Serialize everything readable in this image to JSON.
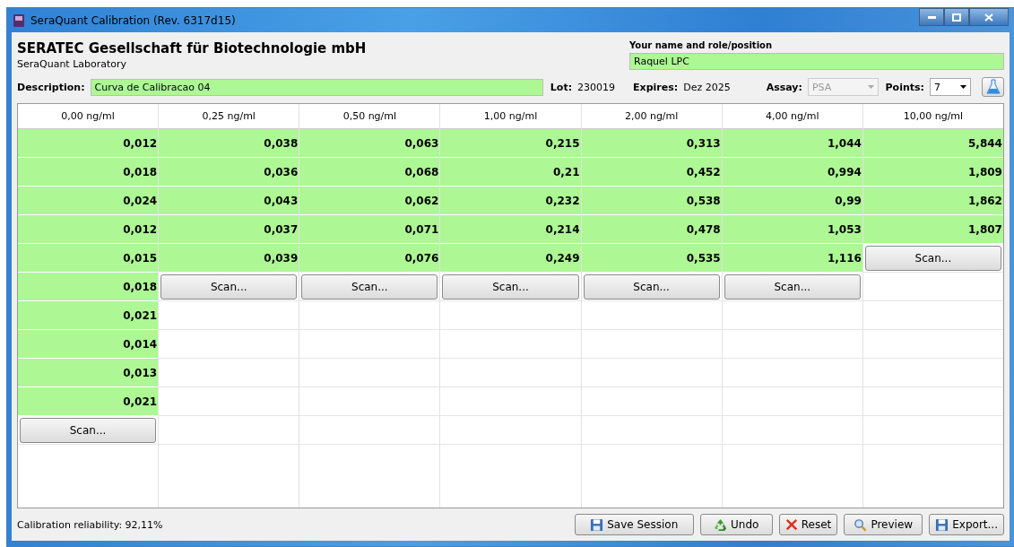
{
  "window": {
    "title": "SeraQuant Calibration (Rev. 6317d15)"
  },
  "header": {
    "company": "SERATEC Gesellschaft für Biotechnologie mbH",
    "subtitle": "SeraQuant Laboratory",
    "name_label": "Your name and role/position",
    "name_value": "Raquel LPC"
  },
  "info": {
    "description_label": "Description:",
    "description_value": "Curva de Calibracao 04",
    "lot_label": "Lot:",
    "lot_value": "230019",
    "expires_label": "Expires:",
    "expires_value": "Dez 2025",
    "assay_label": "Assay:",
    "assay_value": "PSA",
    "assay_disabled": true,
    "points_label": "Points:",
    "points_value": "7"
  },
  "columns": [
    {
      "header": "0,00 ng/ml",
      "values": [
        "0,012",
        "0,018",
        "0,024",
        "0,012",
        "0,015",
        "0,018",
        "0,021",
        "0,014",
        "0,013",
        "0,021"
      ],
      "scan": "Scan..."
    },
    {
      "header": "0,25 ng/ml",
      "values": [
        "0,038",
        "0,036",
        "0,043",
        "0,037",
        "0,039"
      ],
      "scan": "Scan..."
    },
    {
      "header": "0,50 ng/ml",
      "values": [
        "0,063",
        "0,068",
        "0,062",
        "0,071",
        "0,076"
      ],
      "scan": "Scan..."
    },
    {
      "header": "1,00 ng/ml",
      "values": [
        "0,215",
        "0,21",
        "0,232",
        "0,214",
        "0,249"
      ],
      "scan": "Scan..."
    },
    {
      "header": "2,00 ng/ml",
      "values": [
        "0,313",
        "0,452",
        "0,538",
        "0,478",
        "0,535"
      ],
      "scan": "Scan..."
    },
    {
      "header": "4,00 ng/ml",
      "values": [
        "1,044",
        "0,994",
        "0,99",
        "1,053",
        "1,116"
      ],
      "scan": "Scan..."
    },
    {
      "header": "10,00 ng/ml",
      "values": [
        "5,844",
        "1,809",
        "1,862",
        "1,807"
      ],
      "scan": "Scan..."
    }
  ],
  "status": {
    "reliability": "Calibration reliability: 92,11%"
  },
  "buttons": [
    {
      "kind": "save",
      "label": "Save Session"
    },
    {
      "kind": "undo",
      "label": "Undo"
    },
    {
      "kind": "reset",
      "label": "Reset"
    },
    {
      "kind": "preview",
      "label": "Preview"
    },
    {
      "kind": "export",
      "label": "Export..."
    }
  ]
}
